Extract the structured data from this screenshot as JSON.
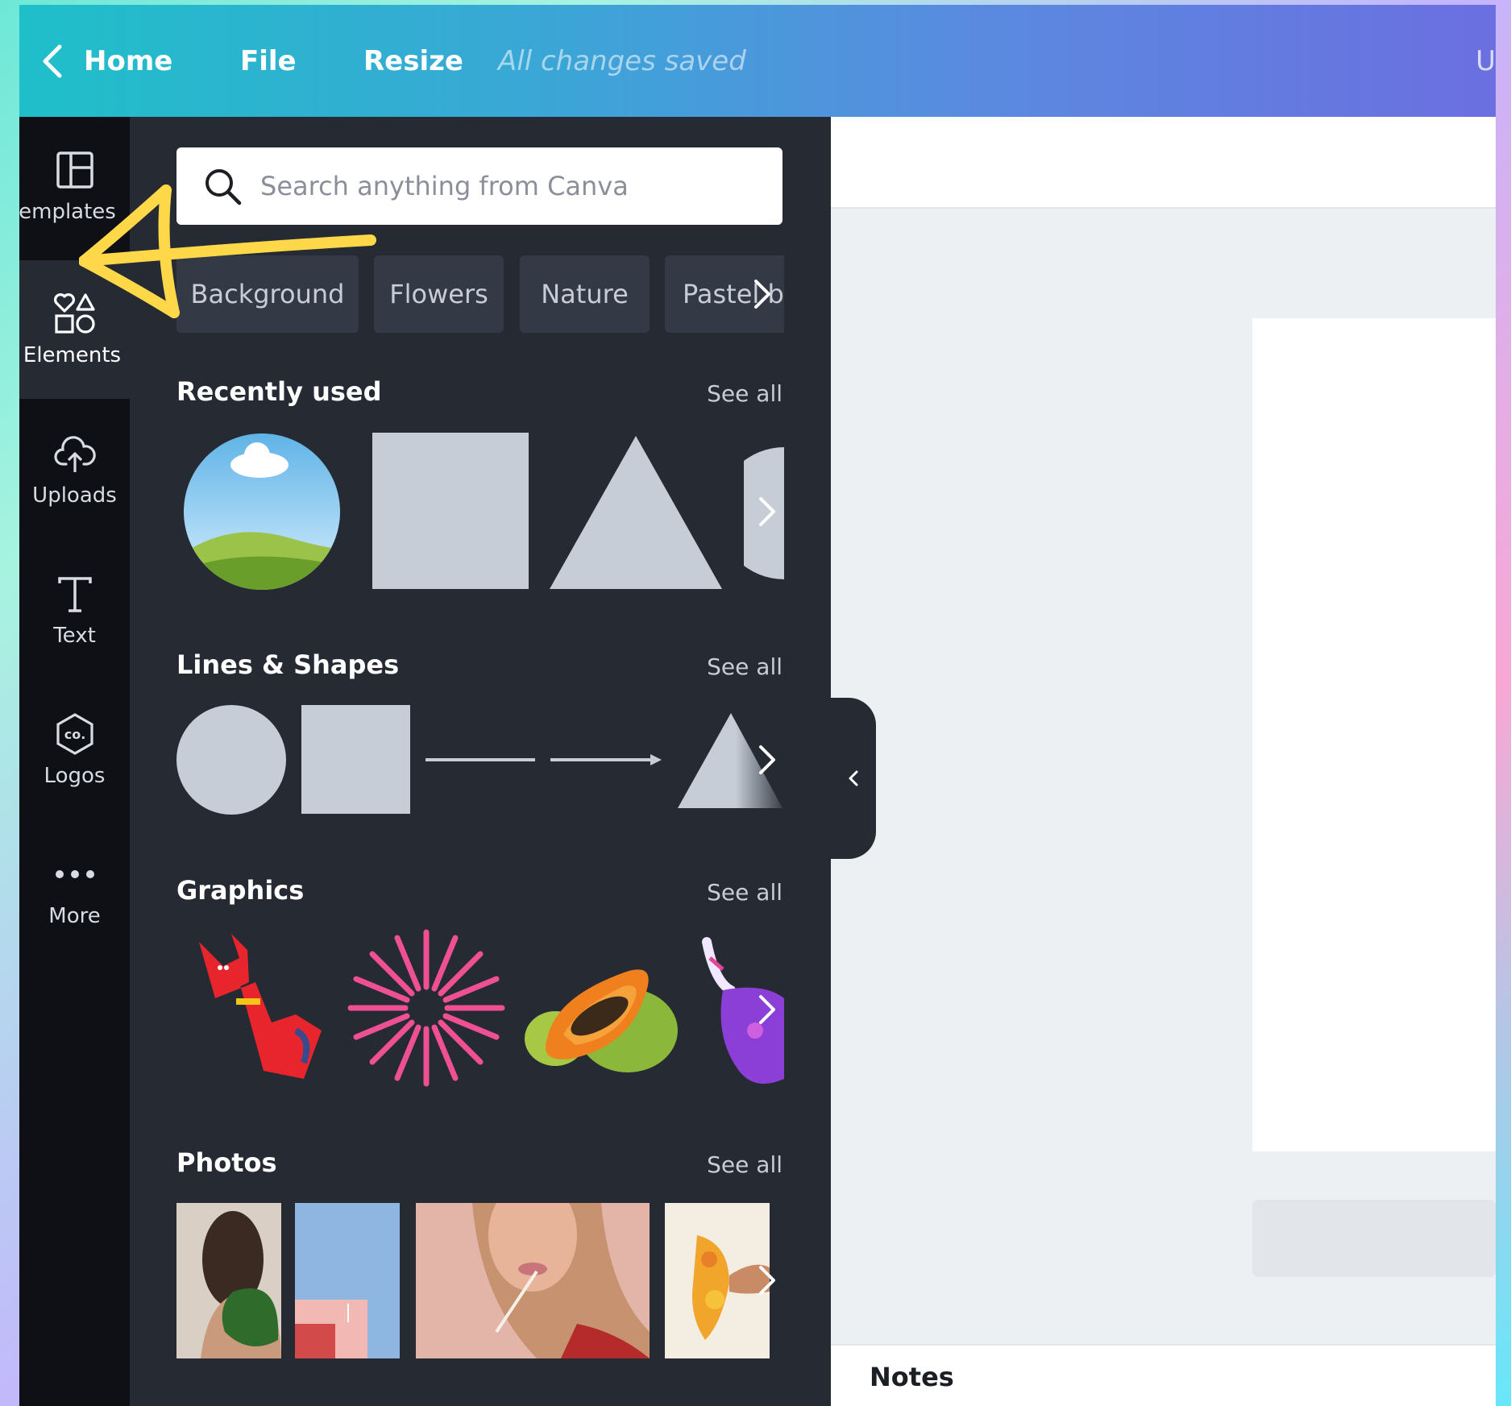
{
  "topbar": {
    "home": "Home",
    "file": "File",
    "resize": "Resize",
    "status": "All changes saved",
    "user_initial": "U"
  },
  "nav": [
    {
      "label": "emplates",
      "icon": "templates-icon"
    },
    {
      "label": "Elements",
      "icon": "elements-icon"
    },
    {
      "label": "Uploads",
      "icon": "upload-cloud-icon"
    },
    {
      "label": "Text",
      "icon": "text-icon"
    },
    {
      "label": "Logos",
      "icon": "logo-badge-icon"
    },
    {
      "label": "More",
      "icon": "more-dots-icon"
    }
  ],
  "search": {
    "placeholder": "Search anything from Canva"
  },
  "chips": [
    "Background",
    "Flowers",
    "Nature",
    "Pastel b"
  ],
  "sections": {
    "recent": {
      "title": "Recently used",
      "see_all": "See all"
    },
    "lines": {
      "title": "Lines & Shapes",
      "see_all": "See all"
    },
    "graphics": {
      "title": "Graphics",
      "see_all": "See all"
    },
    "photos": {
      "title": "Photos",
      "see_all": "See all"
    }
  },
  "notes": {
    "label": "Notes"
  },
  "colors": {
    "panel": "#252a33",
    "sidebar": "#0e1015",
    "shape_gray": "#c7cdd6",
    "annotation_yellow": "#ffd84a"
  }
}
